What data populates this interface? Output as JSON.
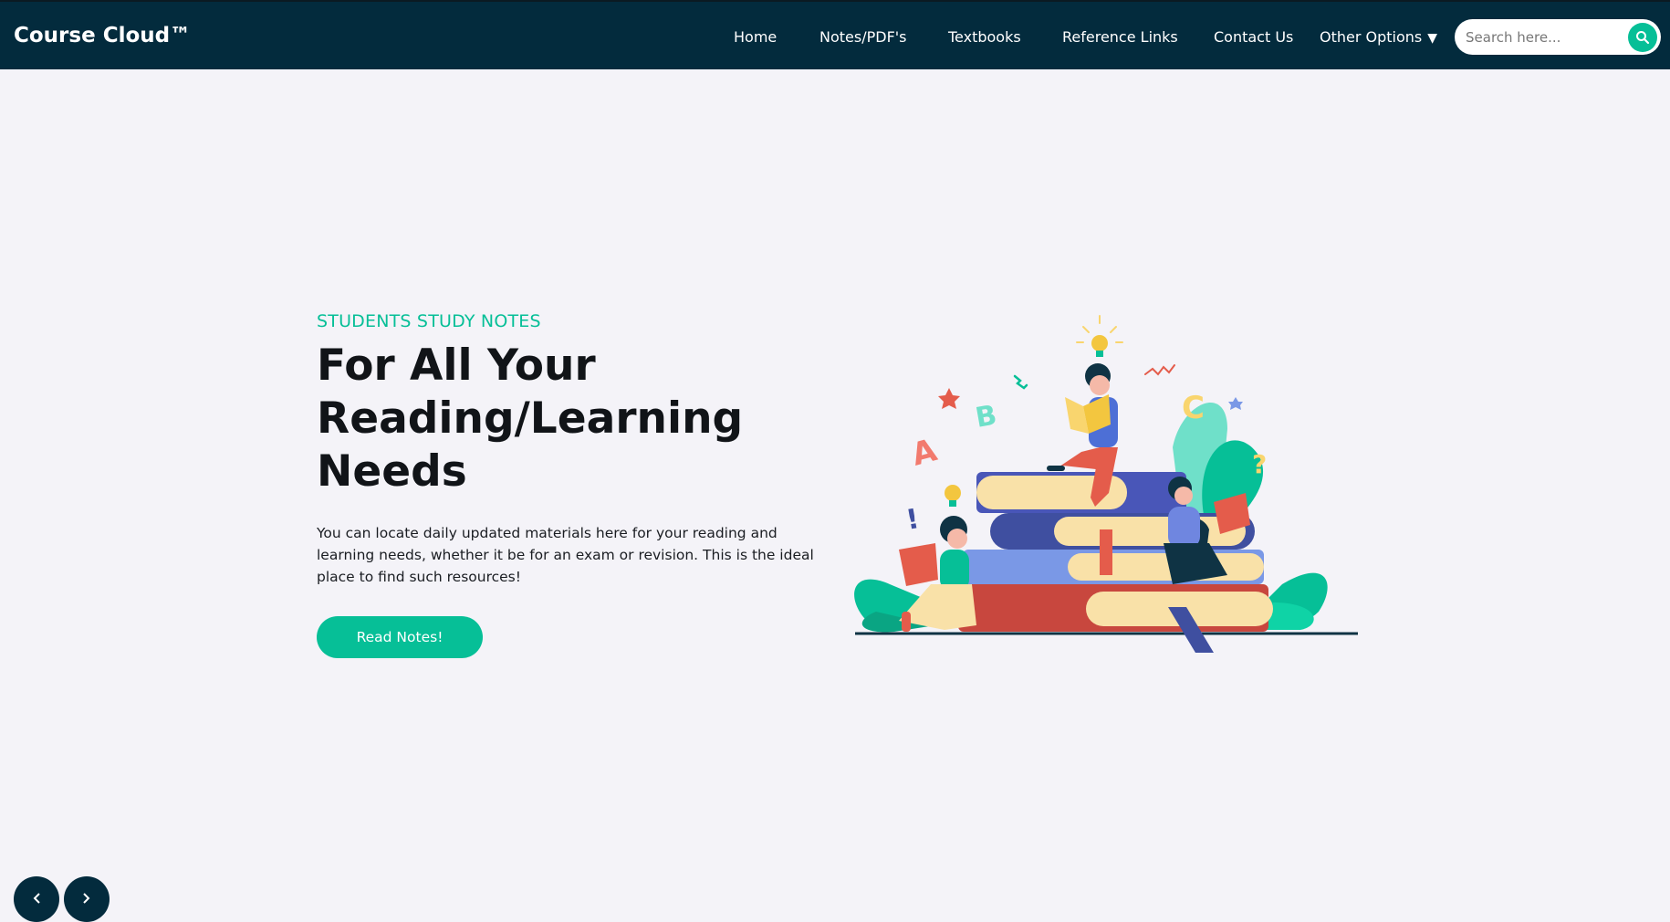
{
  "header": {
    "brand": "Course Cloud™",
    "nav": [
      {
        "label": "Home"
      },
      {
        "label": "Notes/PDF's"
      },
      {
        "label": "Textbooks"
      },
      {
        "label": "Reference Links"
      },
      {
        "label": "Contact Us"
      },
      {
        "label": "Other Options"
      }
    ],
    "dropdown_caret": "▼",
    "search": {
      "placeholder": "Search here..."
    }
  },
  "hero": {
    "eyebrow": "STUDENTS STUDY NOTES",
    "headline": "For All Your Reading/Learning Needs",
    "description": "You can locate daily updated materials here for your reading and learning needs, whether it be for an exam or revision. This is the ideal place to find such resources!",
    "cta_label": "Read Notes!",
    "illustration_letters": [
      "A",
      "B",
      "C",
      "?",
      "!"
    ]
  },
  "colors": {
    "navbar": "#032b3d",
    "accent": "#06bf97",
    "background": "#f4f3f8"
  }
}
